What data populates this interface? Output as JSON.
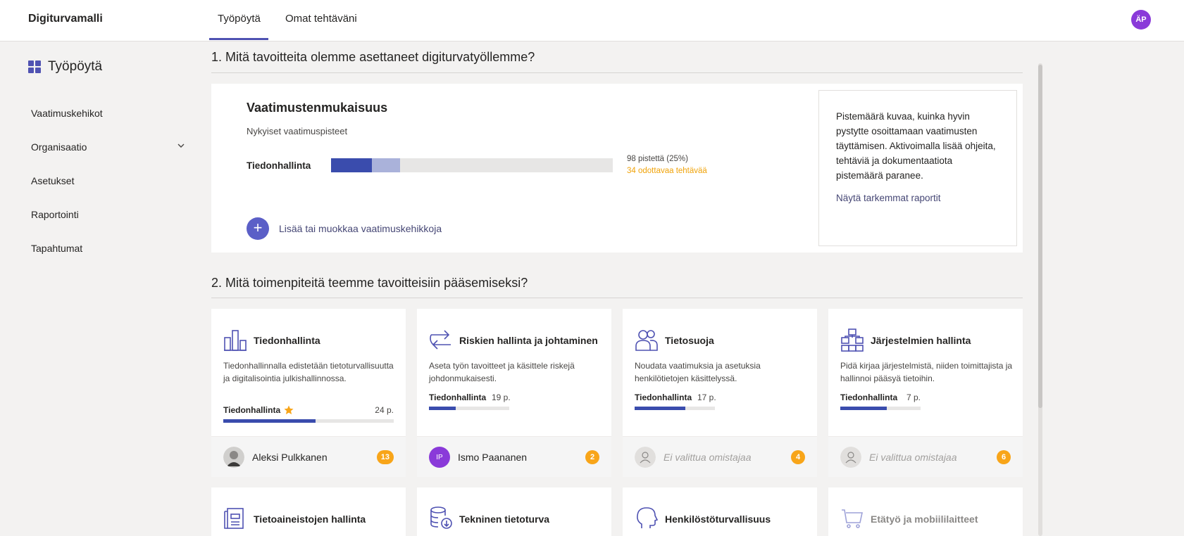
{
  "header": {
    "app_title": "Digiturvamalli",
    "tabs": [
      {
        "label": "Työpöytä",
        "active": true
      },
      {
        "label": "Omat tehtäväni",
        "active": false
      }
    ],
    "user_initials": "ÄP"
  },
  "sidebar": {
    "title": "Työpöytä",
    "items": [
      {
        "label": "Vaatimuskehikot"
      },
      {
        "label": "Organisaatio",
        "has_chevron": true
      },
      {
        "label": "Asetukset"
      },
      {
        "label": "Raportointi"
      },
      {
        "label": "Tapahtumat"
      }
    ]
  },
  "section1": {
    "heading": "1. Mitä tavoitteita olemme asettaneet digiturvatyöllemme?",
    "panel": {
      "title": "Vaatimustenmukaisuus",
      "subtitle": "Nykyiset vaatimuspisteet",
      "row_label": "Tiedonhallinta",
      "progress_fraction": 0.145,
      "pending_fraction": 0.1,
      "points_text": "98 pistettä (25%)",
      "pending_text": "34 odottavaa tehtävää",
      "add_label": "Lisää tai muokkaa vaatimuskehikkoja"
    },
    "info": {
      "text": "Pistemäärä kuvaa, kuinka hyvin pystytte osoittamaan vaatimusten täyttämisen. Aktivoimalla lisää ohjeita, tehtäviä ja dokumentaatiota pistemäärä paranee.",
      "link": "Näytä tarkemmat raportit"
    }
  },
  "section2": {
    "heading": "2. Mitä toimenpiteitä teemme tavoitteisiin pääsemiseksi?",
    "cards": [
      {
        "title": "Tiedonhallinta",
        "icon": "building-icon",
        "desc": "Tiedonhallinnalla edistetään tietoturvallisuutta ja digitalisointia julkishallinnossa.",
        "category": "Tiedonhallinta",
        "points": "24 p.",
        "progress": 0.54,
        "owner": "Aleksi Pulkkanen",
        "owner_initials": "",
        "badge": "13"
      },
      {
        "title": "Riskien hallinta ja johtaminen",
        "icon": "arrows-icon",
        "desc": "Aseta työn tavoitteet ja käsittele riskejä johdonmukaisesti.",
        "category": "Tiedonhallinta",
        "points": "19 p.",
        "progress": 0.33,
        "owner": "Ismo Paananen",
        "owner_initials": "IP",
        "badge": "2"
      },
      {
        "title": "Tietosuoja",
        "icon": "people-icon",
        "desc": "Noudata vaatimuksia ja asetuksia henkilötietojen käsittelyssä.",
        "category": "Tiedonhallinta",
        "points": "17 p.",
        "progress": 0.63,
        "owner": "Ei valittua omistajaa",
        "owner_initials": "",
        "badge": "4"
      },
      {
        "title": "Järjestelmien hallinta",
        "icon": "org-chart-icon",
        "desc": "Pidä kirjaa järjestelmistä, niiden toimittajista ja hallinnoi pääsyä tietoihin.",
        "category": "Tiedonhallinta",
        "points": "7 p.",
        "progress": 0.58,
        "owner": "Ei valittua omistajaa",
        "owner_initials": "",
        "badge": "6"
      }
    ],
    "cards_row2": [
      {
        "title": "Tietoaineistojen hallinta",
        "icon": "document-icon"
      },
      {
        "title": "Tekninen tietoturva",
        "icon": "database-icon"
      },
      {
        "title": "Henkilöstöturvallisuus",
        "icon": "head-icon"
      },
      {
        "title": "Etätyö ja mobiililaitteet",
        "icon": "device-icon"
      }
    ]
  },
  "colors": {
    "accent": "#4f52b2",
    "progress": "#3a4cad",
    "pending": "#aab2da",
    "warning": "#f0a30a",
    "badge": "#f8a519"
  }
}
